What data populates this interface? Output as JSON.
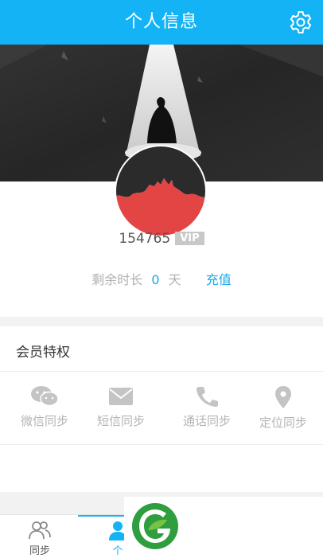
{
  "header": {
    "title": "个人信息",
    "settings_icon": "gear-icon"
  },
  "profile": {
    "user_id": "154765",
    "vip_badge": "VIP",
    "remaining_label": "剩余时长",
    "remaining_value": "0",
    "remaining_unit": "天",
    "recharge_label": "充值"
  },
  "perks": {
    "title": "会员特权",
    "items": [
      {
        "label": "微信同步",
        "icon": "wechat-icon"
      },
      {
        "label": "短信同步",
        "icon": "mail-icon"
      },
      {
        "label": "通话同步",
        "icon": "phone-icon"
      },
      {
        "label": "定位同步",
        "icon": "location-icon"
      }
    ]
  },
  "tabs": [
    {
      "label": "同步",
      "icon": "contacts-icon"
    },
    {
      "label": "个",
      "icon": "person-icon",
      "active": true
    }
  ],
  "colors": {
    "accent": "#14b3f6",
    "vip_badge": "#c8c8c8",
    "banner": "#2b2b2b",
    "avatar_red": "#e34444"
  }
}
